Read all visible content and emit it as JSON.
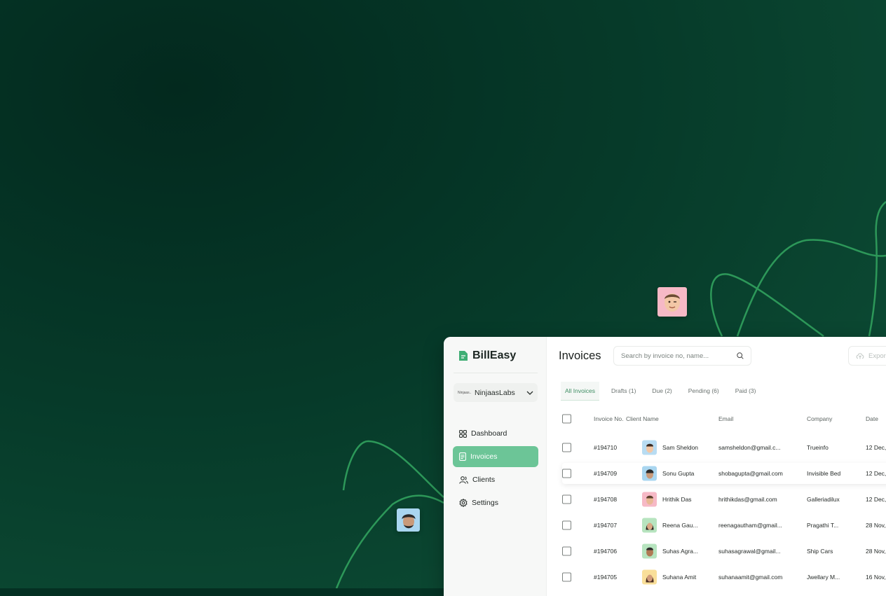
{
  "app": {
    "name": "BillEasy",
    "workspace": {
      "logo_text": "Ninjaas..",
      "name": "NinjaasLabs"
    }
  },
  "sidebar": {
    "items": [
      {
        "label": "Dashboard",
        "icon": "grid-icon",
        "active": false
      },
      {
        "label": "Invoices",
        "icon": "document-icon",
        "active": true
      },
      {
        "label": "Clients",
        "icon": "users-icon",
        "active": false
      },
      {
        "label": "Settings",
        "icon": "gear-icon",
        "active": false
      }
    ]
  },
  "header": {
    "title": "Invoices",
    "search_placeholder": "Search by invoice no, name...",
    "export_label": "Export"
  },
  "tabs": [
    {
      "label": "All Invoices",
      "active": true
    },
    {
      "label": "Drafts (1)",
      "active": false
    },
    {
      "label": "Due (2)",
      "active": false
    },
    {
      "label": "Pending (6)",
      "active": false
    },
    {
      "label": "Paid (3)",
      "active": false
    }
  ],
  "table": {
    "columns": [
      "Invoice No.",
      "Client Name",
      "Email",
      "Company",
      "Date"
    ],
    "rows": [
      {
        "invoice": "#194710",
        "name": "Sam Sheldon",
        "email": "samsheldon@gmail.c...",
        "company": "Trueinfo",
        "date": "12 Dec,",
        "avatar_bg": "#b8dcf2"
      },
      {
        "invoice": "#194709",
        "name": "Sonu Gupta",
        "email": "shobagupta@gmail.com",
        "company": "Invisible Bed",
        "date": "12 Dec,",
        "avatar_bg": "#a9d6f0"
      },
      {
        "invoice": "#194708",
        "name": "Hrithik Das",
        "email": "hrithikdas@gmail.com",
        "company": "Galleriadilux",
        "date": "12 Dec,",
        "avatar_bg": "#f6b9c6"
      },
      {
        "invoice": "#194707",
        "name": "Reena Gau...",
        "email": "reenagautham@gmail...",
        "company": "Pragathi T...",
        "date": "28 Nov,",
        "avatar_bg": "#b7e4bf"
      },
      {
        "invoice": "#194706",
        "name": "Suhas Agra...",
        "email": "suhasagrawal@gmail...",
        "company": "Ship Cars",
        "date": "28 Nov,",
        "avatar_bg": "#b7e4bf"
      },
      {
        "invoice": "#194705",
        "name": "Suhana Amit",
        "email": "suhanaamit@gmail.com",
        "company": "Jwellary M...",
        "date": "16 Nov,",
        "avatar_bg": "#f9df9a"
      }
    ]
  },
  "colors": {
    "accent": "#6cc597",
    "background": "#063a29",
    "line": "#2f9d5c"
  }
}
